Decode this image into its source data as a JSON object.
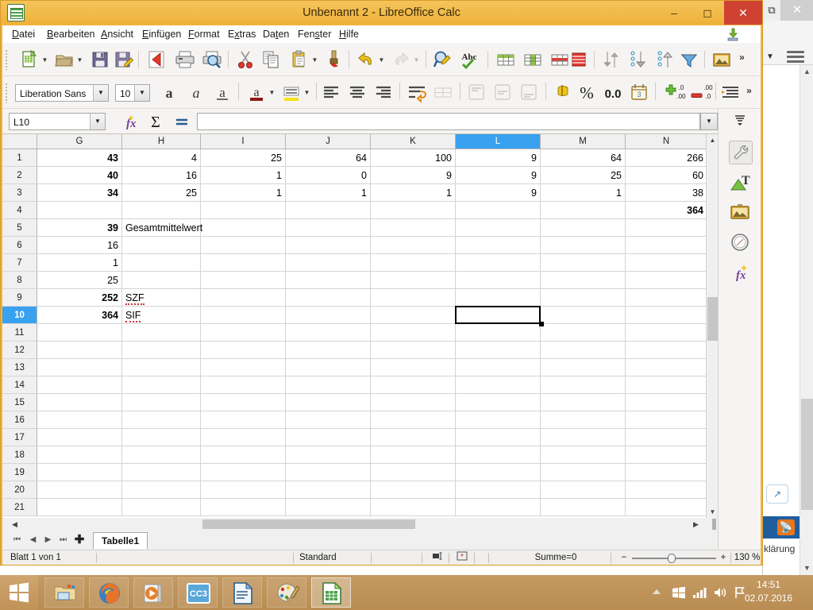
{
  "window": {
    "title": "Unbenannt 2 - LibreOffice Calc",
    "app_icon": "calc-document-icon",
    "minimize_label": "–",
    "maximize_label": "❐",
    "close_label": "✕"
  },
  "menubar": {
    "items": [
      {
        "label": "Datei",
        "accel": "D"
      },
      {
        "label": "Bearbeiten",
        "accel": "B"
      },
      {
        "label": "Ansicht",
        "accel": "A"
      },
      {
        "label": "Einfügen",
        "accel": "E"
      },
      {
        "label": "Format",
        "accel": "F"
      },
      {
        "label": "Extras",
        "accel": "x"
      },
      {
        "label": "Daten",
        "accel": "t"
      },
      {
        "label": "Fenster",
        "accel": "s"
      },
      {
        "label": "Hilfe",
        "accel": "H"
      }
    ],
    "download_icon": "download-update-icon"
  },
  "toolbar_standard": {
    "buttons": [
      {
        "name": "new-document-button",
        "icon": "new-spreadsheet-icon"
      },
      {
        "name": "open-document-button",
        "icon": "open-folder-icon"
      },
      {
        "name": "save-button",
        "icon": "floppy-disk-icon"
      },
      {
        "name": "save-as-button",
        "icon": "floppy-pencil-icon"
      },
      {
        "name": "export-pdf-button",
        "icon": "pdf-icon"
      },
      {
        "name": "print-button",
        "icon": "printer-icon"
      },
      {
        "name": "print-preview-button",
        "icon": "print-preview-icon"
      },
      {
        "name": "cut-button",
        "icon": "scissors-icon"
      },
      {
        "name": "copy-button",
        "icon": "copy-icon"
      },
      {
        "name": "paste-button",
        "icon": "clipboard-icon"
      },
      {
        "name": "clone-formatting-button",
        "icon": "paintbrush-icon"
      },
      {
        "name": "undo-button",
        "icon": "undo-arrow-icon"
      },
      {
        "name": "redo-button",
        "icon": "redo-arrow-icon"
      },
      {
        "name": "find-replace-button",
        "icon": "magnifier-pencil-icon"
      },
      {
        "name": "spelling-button",
        "icon": "abc-check-icon"
      },
      {
        "name": "table-button",
        "icon": "table-grid-icon"
      },
      {
        "name": "column-button",
        "icon": "table-column-icon"
      },
      {
        "name": "row-button",
        "icon": "table-row-icon"
      },
      {
        "name": "delete-row-button",
        "icon": "table-delete-row-icon"
      },
      {
        "name": "sort-button",
        "icon": "sort-updown-icon"
      },
      {
        "name": "sort-ascending-button",
        "icon": "sort-ascending-icon"
      },
      {
        "name": "sort-descending-button",
        "icon": "sort-descending-icon"
      },
      {
        "name": "autofilter-button",
        "icon": "funnel-icon"
      },
      {
        "name": "insert-image-button",
        "icon": "picture-icon"
      }
    ],
    "overflow_label": "»"
  },
  "toolbar_formatting": {
    "font_name": "Liberation Sans",
    "font_size": "10",
    "buttons": [
      {
        "name": "bold-button",
        "icon": "bold-a-icon",
        "label": "a"
      },
      {
        "name": "italic-button",
        "icon": "italic-a-icon",
        "label": "a"
      },
      {
        "name": "underline-button",
        "icon": "underline-a-icon",
        "label": "a"
      },
      {
        "name": "font-color-button",
        "icon": "font-color-icon",
        "label": "a"
      },
      {
        "name": "highlight-color-button",
        "icon": "highlight-color-icon"
      },
      {
        "name": "align-left-button",
        "icon": "align-left-icon"
      },
      {
        "name": "align-center-button",
        "icon": "align-center-icon"
      },
      {
        "name": "align-right-button",
        "icon": "align-right-icon"
      },
      {
        "name": "wrap-text-button",
        "icon": "wrap-text-icon"
      },
      {
        "name": "merge-cells-button",
        "icon": "merge-cells-icon"
      },
      {
        "name": "align-top-button",
        "icon": "align-top-icon"
      },
      {
        "name": "align-middle-button",
        "icon": "align-middle-icon"
      },
      {
        "name": "align-bottom-button",
        "icon": "align-bottom-icon"
      },
      {
        "name": "format-currency-button",
        "icon": "currency-coins-icon"
      },
      {
        "name": "format-percent-button",
        "icon": "percent-icon",
        "label": "%"
      },
      {
        "name": "format-number-button",
        "icon": "decimal-number-icon",
        "label": "0.0"
      },
      {
        "name": "format-date-button",
        "icon": "calendar-icon"
      },
      {
        "name": "add-decimal-button",
        "icon": "add-decimal-icon"
      },
      {
        "name": "delete-decimal-button",
        "icon": "delete-decimal-icon"
      },
      {
        "name": "indent-button",
        "icon": "increase-indent-icon"
      }
    ],
    "overflow_label": "»"
  },
  "formula_bar": {
    "name_box_value": "L10",
    "function_wizard_icon": "fx-wizard-icon",
    "sum_icon": "sigma-sum-icon",
    "sum_label": "Σ",
    "formula_icon": "equals-icon",
    "formula_label": "=",
    "input_value": "",
    "dropdown_icon": "chevron-down-icon"
  },
  "sheet": {
    "columns": [
      "G",
      "H",
      "I",
      "J",
      "K",
      "L",
      "M",
      "N"
    ],
    "selected_column": "L",
    "rows": [
      "1",
      "2",
      "3",
      "4",
      "5",
      "6",
      "7",
      "8",
      "9",
      "10",
      "11",
      "12",
      "13",
      "14",
      "15",
      "16",
      "17",
      "18",
      "19",
      "20",
      "21"
    ],
    "selected_row": "10",
    "selected_cell": "L10",
    "data": [
      {
        "row": "1",
        "G": "43",
        "H": "4",
        "I": "25",
        "J": "64",
        "K": "100",
        "L": "9",
        "M": "64",
        "N": "266"
      },
      {
        "row": "2",
        "G": "40",
        "H": "16",
        "I": "1",
        "J": "0",
        "K": "9",
        "L": "9",
        "M": "25",
        "N": "60"
      },
      {
        "row": "3",
        "G": "34",
        "H": "25",
        "I": "1",
        "J": "1",
        "K": "1",
        "L": "9",
        "M": "1",
        "N": "38"
      },
      {
        "row": "4",
        "G": "",
        "H": "",
        "I": "",
        "J": "",
        "K": "",
        "L": "",
        "M": "",
        "N": "364"
      },
      {
        "row": "5",
        "G": "39",
        "H": "Gesamtmittelwert",
        "I": "",
        "J": "",
        "K": "",
        "L": "",
        "M": "",
        "N": ""
      },
      {
        "row": "6",
        "G": "16",
        "H": "",
        "I": "",
        "J": "",
        "K": "",
        "L": "",
        "M": "",
        "N": ""
      },
      {
        "row": "7",
        "G": "1",
        "H": "",
        "I": "",
        "J": "",
        "K": "",
        "L": "",
        "M": "",
        "N": ""
      },
      {
        "row": "8",
        "G": "25",
        "H": "",
        "I": "",
        "J": "",
        "K": "",
        "L": "",
        "M": "",
        "N": ""
      },
      {
        "row": "9",
        "G": "252",
        "H": "SZF",
        "I": "",
        "J": "",
        "K": "",
        "L": "",
        "M": "",
        "N": ""
      },
      {
        "row": "10",
        "G": "364",
        "H": "SIF",
        "I": "",
        "J": "",
        "K": "",
        "L": "",
        "M": "",
        "N": ""
      }
    ],
    "bold_number_cells": [
      "G1",
      "G2",
      "G3",
      "G5",
      "G9",
      "G10",
      "N4"
    ],
    "spellchecked_cells": [
      "H9",
      "H10"
    ]
  },
  "tabbar": {
    "first_icon": "first-sheet-icon",
    "prev_icon": "previous-sheet-icon",
    "next_icon": "next-sheet-icon",
    "last_icon": "last-sheet-icon",
    "add_label": "✚",
    "sheet_name": "Tabelle1"
  },
  "statusbar": {
    "sheet_info": "Blatt 1 von 1",
    "page_style": "Standard",
    "insert_mode_icon": "insert-mode-icon",
    "selection_mode_icon": "selection-mode-icon",
    "modified_icon": "document-modified-icon",
    "sum_text": "Summe=0",
    "zoom_out_label": "−",
    "zoom_in_label": "+",
    "zoom_value": "130 %"
  },
  "sidebar": {
    "menu_icon": "sidebar-settings-icon",
    "items": [
      {
        "name": "sidebar-properties",
        "icon": "wrench-icon",
        "active": true
      },
      {
        "name": "sidebar-styles",
        "icon": "styles-t-icon"
      },
      {
        "name": "sidebar-gallery",
        "icon": "gallery-picture-icon"
      },
      {
        "name": "sidebar-navigator",
        "icon": "compass-navigator-icon"
      },
      {
        "name": "sidebar-functions",
        "icon": "fx-functions-icon"
      }
    ]
  },
  "background_window": {
    "restore_icon": "restore-window-icon",
    "close_label": "✕",
    "menu_icon": "hamburger-menu-icon",
    "rss_icon": "rss-feed-icon",
    "popout_icon": "popout-arrow-icon",
    "bottom_text": "klärung"
  },
  "taskbar": {
    "start_icon": "windows-start-icon",
    "apps": [
      {
        "name": "taskbar-file-explorer",
        "icon": "folder-icon"
      },
      {
        "name": "taskbar-firefox",
        "icon": "firefox-icon"
      },
      {
        "name": "taskbar-media-player",
        "icon": "media-player-icon"
      },
      {
        "name": "taskbar-cc3",
        "icon": "cc3-icon",
        "label": "CC3"
      },
      {
        "name": "taskbar-libreoffice-writer",
        "icon": "writer-document-icon"
      },
      {
        "name": "taskbar-paint",
        "icon": "paint-palette-icon"
      },
      {
        "name": "taskbar-libreoffice-calc",
        "icon": "calc-spreadsheet-icon",
        "active": true
      }
    ],
    "tray": {
      "expand_icon": "show-hidden-icons-icon",
      "windows_icon": "windows-flag-icon",
      "network_icon": "network-signal-icon",
      "volume_icon": "speaker-icon",
      "action_center_icon": "flag-icon",
      "time": "14:51",
      "date": "02.07.2016"
    }
  }
}
